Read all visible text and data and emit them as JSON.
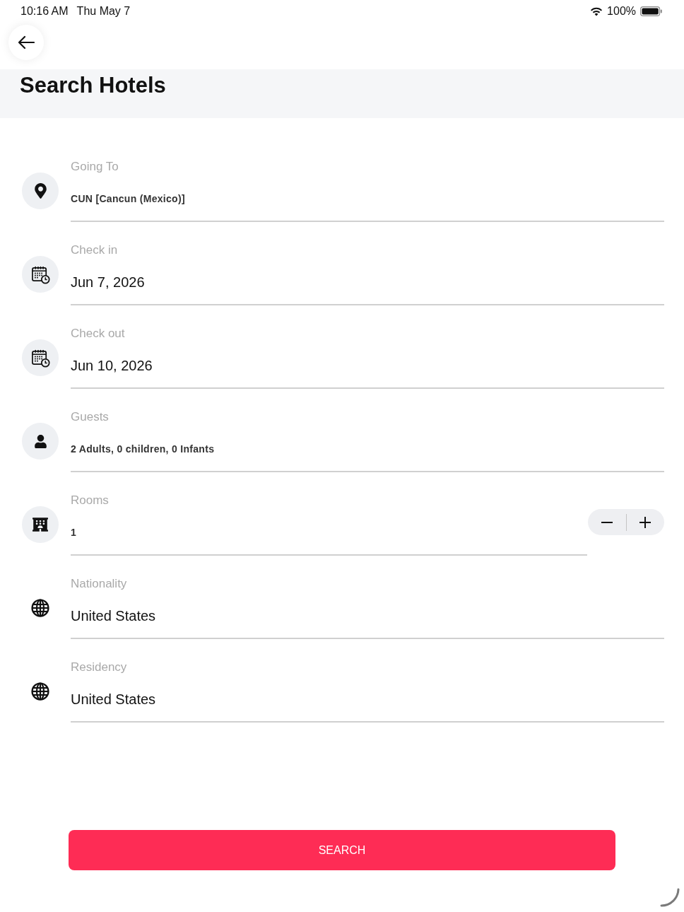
{
  "status_bar": {
    "time": "10:16 AM",
    "date": "Thu May 7",
    "battery": "100%"
  },
  "header": {
    "title": "Search Hotels"
  },
  "fields": [
    {
      "kind": "destination",
      "label": "Going To",
      "value": "CUN [Cancun (Mexico)]"
    },
    {
      "kind": "date",
      "label": "Check in",
      "value": "Jun 7, 2026"
    },
    {
      "kind": "date",
      "label": "Check out",
      "value": "Jun 10, 2026"
    },
    {
      "kind": "guests",
      "label": "Guests",
      "value": "2 Adults, 0 children, 0 Infants"
    },
    {
      "kind": "rooms",
      "label": "Rooms",
      "value": "1"
    },
    {
      "kind": "country",
      "label": "Nationality",
      "value": "United States"
    },
    {
      "kind": "country",
      "label": "Residency",
      "value": "United States"
    }
  ],
  "search_button": {
    "label": "SEARCH"
  }
}
